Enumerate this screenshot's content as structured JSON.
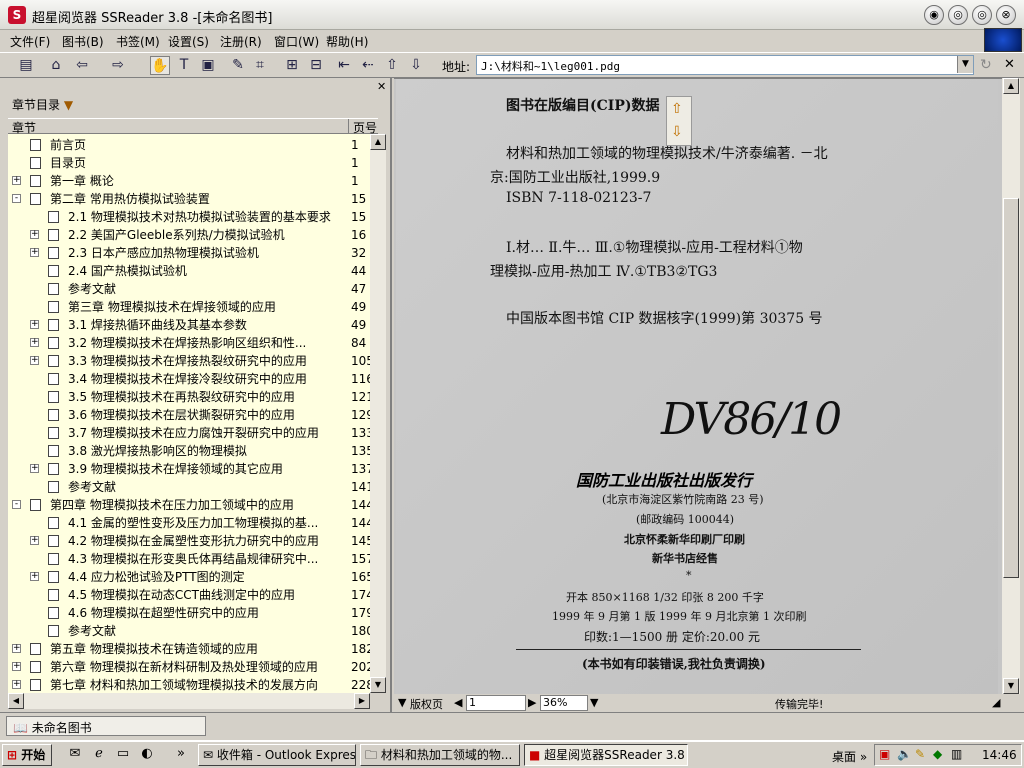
{
  "window": {
    "title": "超星阅览器 SSReader 3.8 -[未命名图书]",
    "controls": {
      "minimize": "◉",
      "restore": "◎",
      "close": "⊗"
    }
  },
  "menu": [
    "文件(F)",
    "图书(B)",
    "书签(M)",
    "设置(S)",
    "注册(R)",
    "窗口(W)",
    "帮助(H)"
  ],
  "address": {
    "label": "地址:",
    "value": "J:\\材料和~1\\leg001.pdg"
  },
  "sidebar": {
    "dropdown": "章节目录",
    "col_chapter": "章节",
    "col_page": "页号",
    "items": [
      {
        "label": "前言页",
        "page": "1",
        "level": 0,
        "expander": ""
      },
      {
        "label": "目录页",
        "page": "1",
        "level": 0,
        "expander": ""
      },
      {
        "label": "第一章 概论",
        "page": "1",
        "level": 0,
        "expander": "+"
      },
      {
        "label": "第二章 常用热仿模拟试验装置",
        "page": "15",
        "level": 0,
        "expander": "-"
      },
      {
        "label": "2.1 物理模拟技术对热功模拟试验装置的基本要求",
        "page": "15",
        "level": 1,
        "expander": ""
      },
      {
        "label": "2.2 美国产Gleeble系列热/力模拟试验机",
        "page": "16",
        "level": 1,
        "expander": "+"
      },
      {
        "label": "2.3 日本产感应加热物理模拟试验机",
        "page": "32",
        "level": 1,
        "expander": "+"
      },
      {
        "label": "2.4 国产热模拟试验机",
        "page": "44",
        "level": 1,
        "expander": ""
      },
      {
        "label": "参考文献",
        "page": "47",
        "level": 1,
        "expander": ""
      },
      {
        "label": "第三章 物理模拟技术在焊接领域的应用",
        "page": "49",
        "level": 1,
        "expander": ""
      },
      {
        "label": "3.1 焊接热循环曲线及其基本参数",
        "page": "49",
        "level": 1,
        "expander": "+"
      },
      {
        "label": "3.2 物理模拟技术在焊接热影响区组织和性...",
        "page": "84",
        "level": 1,
        "expander": "+"
      },
      {
        "label": "3.3 物理模拟技术在焊接热裂纹研究中的应用",
        "page": "105",
        "level": 1,
        "expander": "+"
      },
      {
        "label": "3.4 物理模拟技术在焊接冷裂纹研究中的应用",
        "page": "116",
        "level": 1,
        "expander": ""
      },
      {
        "label": "3.5 物理模拟技术在再热裂纹研究中的应用",
        "page": "121",
        "level": 1,
        "expander": ""
      },
      {
        "label": "3.6 物理模拟技术在层状撕裂研究中的应用",
        "page": "129",
        "level": 1,
        "expander": ""
      },
      {
        "label": "3.7 物理模拟技术在应力腐蚀开裂研究中的应用",
        "page": "133",
        "level": 1,
        "expander": ""
      },
      {
        "label": "3.8 激光焊接热影响区的物理模拟",
        "page": "135",
        "level": 1,
        "expander": ""
      },
      {
        "label": "3.9 物理模拟技术在焊接领域的其它应用",
        "page": "137",
        "level": 1,
        "expander": "+"
      },
      {
        "label": "参考文献",
        "page": "141",
        "level": 1,
        "expander": ""
      },
      {
        "label": "第四章 物理模拟技术在压力加工领域中的应用",
        "page": "144",
        "level": 0,
        "expander": "-"
      },
      {
        "label": "4.1 金属的塑性变形及压力加工物理模拟的基...",
        "page": "144",
        "level": 1,
        "expander": ""
      },
      {
        "label": "4.2 物理模拟在金属塑性变形抗力研究中的应用",
        "page": "145",
        "level": 1,
        "expander": "+"
      },
      {
        "label": "4.3 物理模拟在形变奥氏体再结晶规律研究中...",
        "page": "157",
        "level": 1,
        "expander": ""
      },
      {
        "label": "4.4 应力松弛试验及PTT图的测定",
        "page": "165",
        "level": 1,
        "expander": "+"
      },
      {
        "label": "4.5 物理模拟在动态CCT曲线测定中的应用",
        "page": "174",
        "level": 1,
        "expander": ""
      },
      {
        "label": "4.6 物理模拟在超塑性研究中的应用",
        "page": "179",
        "level": 1,
        "expander": ""
      },
      {
        "label": "参考文献",
        "page": "180",
        "level": 1,
        "expander": ""
      },
      {
        "label": "第五章 物理模拟技术在铸造领域的应用",
        "page": "182",
        "level": 0,
        "expander": "+"
      },
      {
        "label": "第六章 物理模拟在新材料研制及热处理领域的应用",
        "page": "202",
        "level": 0,
        "expander": "+"
      },
      {
        "label": "第七章 材料和热加工领域物理模拟技术的发展方向",
        "page": "228",
        "level": 0,
        "expander": "+"
      }
    ]
  },
  "document": {
    "cip_title": "图书在版编目(CIP)数据",
    "line1": "材料和热加工领域的物理模拟技术/牛济泰编著. －北",
    "line2": "京:国防工业出版社,1999.9",
    "line3": "ISBN 7-118-02123-7",
    "line4": "Ⅰ.材… Ⅱ.牛… Ⅲ.①物理模拟-应用-工程材料①物",
    "line5": "理模拟-应用-热加工 Ⅳ.①TB3②TG3",
    "line6": "中国版本图书馆 CIP 数据核字(1999)第 30375 号",
    "signature": "DV86/10",
    "publisher": "国防工业出版社出版发行",
    "address": "(北京市海淀区紫竹院南路 23 号)",
    "postcode": "(邮政编码  100044)",
    "printer": "北京怀柔新华印刷厂印刷",
    "distributor": "新华书店经售",
    "star": "*",
    "format": "开本 850×1168  1/32     印张 8      200 千字",
    "edition": "1999 年 9 月第 1 版     1999 年 9 月北京第 1 次印刷",
    "print_run": "印数:1—1500 册     定价:20.00 元",
    "notice": "(本书如有印装错误,我社负责调换)"
  },
  "status": {
    "page_label": "版权页",
    "page_value": "1",
    "zoom": "36%",
    "message": "传输完毕!"
  },
  "bottom_tab": "未命名图书",
  "taskbar": {
    "start": "开始",
    "more": "»",
    "tasks": [
      "收件箱 - Outlook Express",
      "材料和热加工领域的物...",
      "超星阅览器SSReader 3.8"
    ],
    "desktop": "桌面",
    "desktop_more": "»",
    "time": "14:46"
  }
}
